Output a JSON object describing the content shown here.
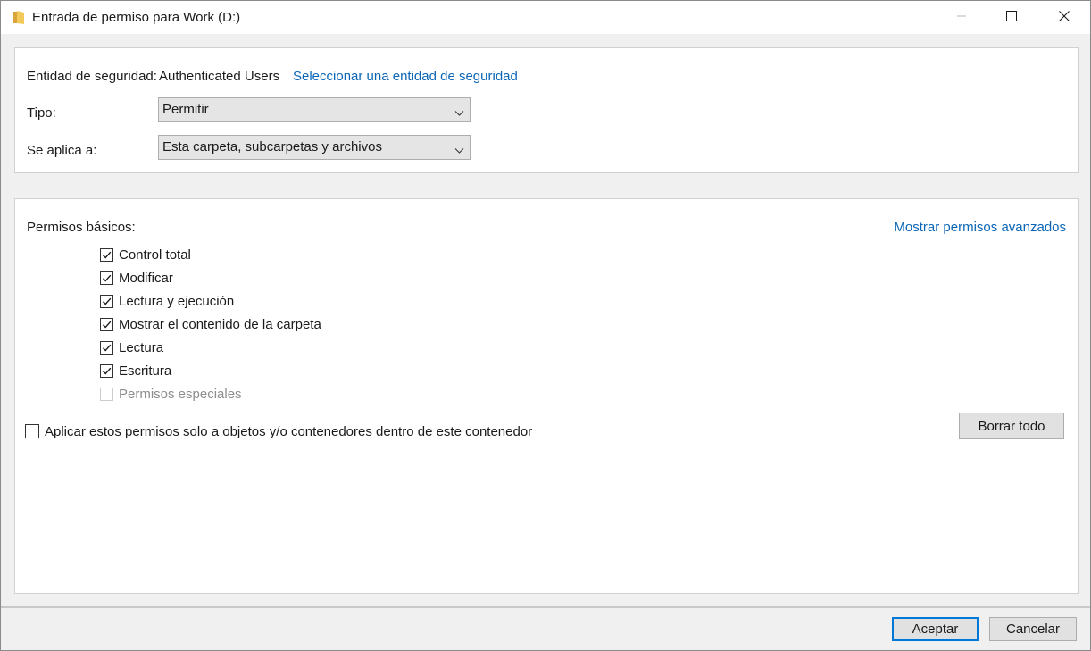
{
  "window": {
    "title": "Entrada de permiso para Work (D:)",
    "icon": "folder-icon",
    "controls": [
      "minimize-icon",
      "maximize-icon",
      "close-icon"
    ]
  },
  "principal": {
    "label": "Entidad de seguridad:",
    "value": "Authenticated Users",
    "select_link": "Seleccionar una entidad de seguridad"
  },
  "type": {
    "label": "Tipo:",
    "value": "Permitir"
  },
  "applies_to": {
    "label": "Se aplica a:",
    "value": "Esta carpeta, subcarpetas y archivos"
  },
  "basic_permissions": {
    "label": "Permisos básicos:",
    "advanced_link": "Mostrar permisos avanzados",
    "items": [
      {
        "label": "Control total",
        "checked": true,
        "enabled": true
      },
      {
        "label": "Modificar",
        "checked": true,
        "enabled": true
      },
      {
        "label": "Lectura y ejecución",
        "checked": true,
        "enabled": true
      },
      {
        "label": "Mostrar el contenido de la carpeta",
        "checked": true,
        "enabled": true
      },
      {
        "label": "Lectura",
        "checked": true,
        "enabled": true
      },
      {
        "label": "Escritura",
        "checked": true,
        "enabled": true
      },
      {
        "label": "Permisos especiales",
        "checked": false,
        "enabled": false
      }
    ]
  },
  "apply_only": {
    "label": "Aplicar estos permisos solo a objetos y/o contenedores dentro de este contenedor",
    "checked": false
  },
  "buttons": {
    "clear_all": "Borrar todo",
    "ok": "Aceptar",
    "cancel": "Cancelar"
  },
  "colors": {
    "link": "#0b66b6",
    "default_button_border": "#0078d7",
    "folder": "#e8b84a"
  }
}
